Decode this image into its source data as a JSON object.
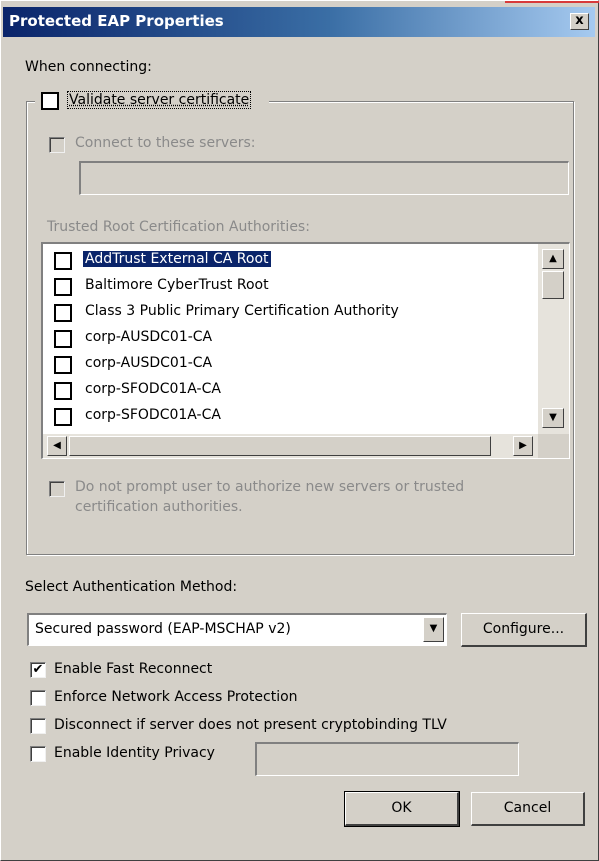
{
  "window": {
    "title": "Protected EAP Properties",
    "close_glyph": "x"
  },
  "when_connecting_label": "When connecting:",
  "validate_cert": {
    "label": "Validate server certificate",
    "checked": false
  },
  "connect_servers": {
    "label": "Connect to these servers:",
    "checked": false,
    "value": ""
  },
  "trusted_root_label": "Trusted Root Certification Authorities:",
  "cert_list": [
    {
      "label": "AddTrust External CA Root",
      "checked": false,
      "selected": true
    },
    {
      "label": "Baltimore CyberTrust Root",
      "checked": false,
      "selected": false
    },
    {
      "label": "Class 3 Public Primary Certification Authority",
      "checked": false,
      "selected": false
    },
    {
      "label": "corp-AUSDC01-CA",
      "checked": false,
      "selected": false
    },
    {
      "label": "corp-AUSDC01-CA",
      "checked": false,
      "selected": false
    },
    {
      "label": "corp-SFODC01A-CA",
      "checked": false,
      "selected": false
    },
    {
      "label": "corp-SFODC01A-CA",
      "checked": false,
      "selected": false
    }
  ],
  "no_prompt": {
    "line1": "Do not prompt user to authorize new servers or trusted",
    "line2": "certification authorities.",
    "checked": false
  },
  "auth_method_label": "Select Authentication Method:",
  "auth_method_value": "Secured password (EAP-MSCHAP v2)",
  "configure_label": "Configure...",
  "options": [
    {
      "label": "Enable Fast Reconnect",
      "checked": true
    },
    {
      "label": "Enforce Network Access Protection",
      "checked": false
    },
    {
      "label": "Disconnect if server does not present cryptobinding TLV",
      "checked": false
    },
    {
      "label": "Enable Identity Privacy",
      "checked": false
    }
  ],
  "identity_privacy_value": "",
  "ok_label": "OK",
  "cancel_label": "Cancel",
  "icons": {
    "checkmark": "✔",
    "scroll_up": "▲",
    "scroll_down": "▼",
    "scroll_left": "◀",
    "scroll_right": "▶",
    "dropdown": "▼"
  },
  "colors": {
    "titlebar_start": "#0a246a",
    "titlebar_end": "#a6caf0",
    "dialog_face": "#d4d0c8",
    "selection": "#0a246a",
    "disabled_text": "#8a8a8a"
  }
}
